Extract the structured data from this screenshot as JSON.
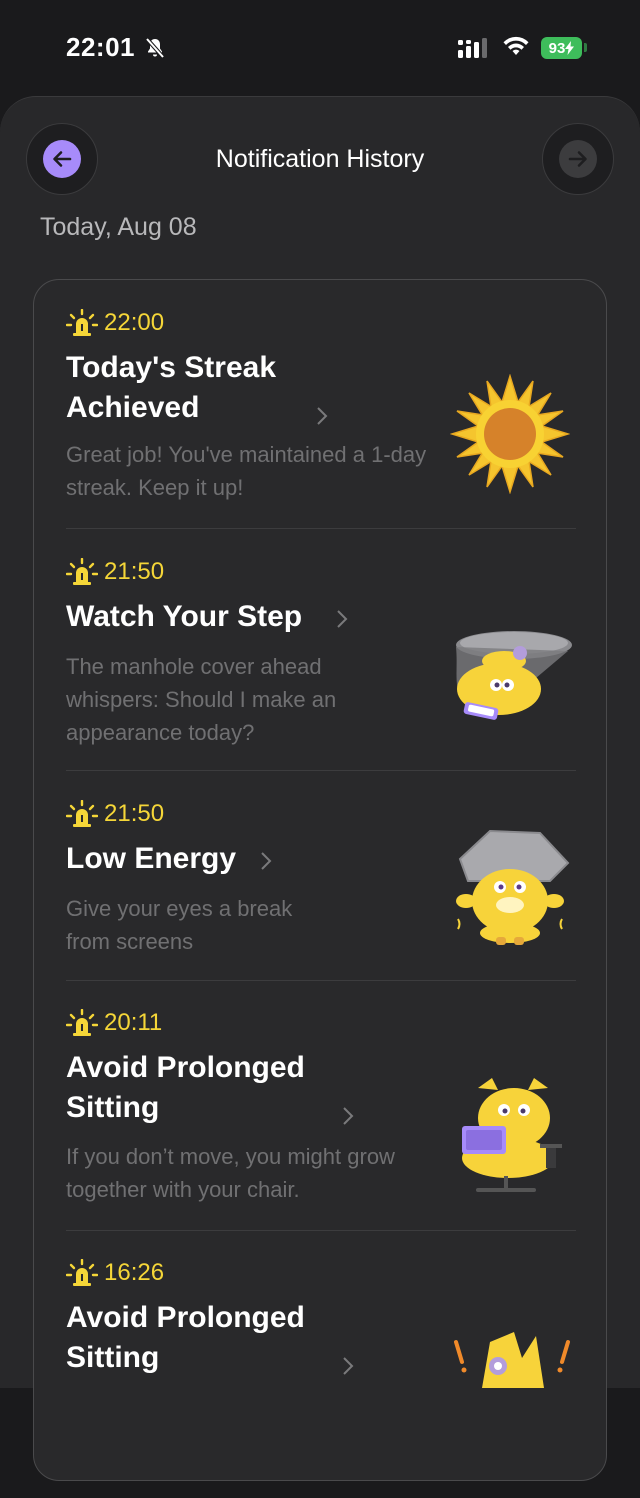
{
  "status_bar": {
    "time": "22:01",
    "battery": "93"
  },
  "header": {
    "title": "Notification History"
  },
  "date_label": "Today, Aug 08",
  "notifications": [
    {
      "time": "22:00",
      "title": "Today's Streak Achieved",
      "desc": "Great job! You've maintained a 1-day streak. Keep it up!",
      "icon": "sunflower-illustration"
    },
    {
      "time": "21:50",
      "title": "Watch Your Step",
      "desc": "The manhole cover ahead whispers: Should I make an appearance today?",
      "icon": "manhole-cat-illustration"
    },
    {
      "time": "21:50",
      "title": "Low Energy",
      "desc": "Give your eyes a break from screens",
      "icon": "tired-cat-illustration"
    },
    {
      "time": "20:11",
      "title": "Avoid Prolonged Sitting",
      "desc": "If you don’t move, you might grow together with your chair.",
      "icon": "laptop-cat-illustration"
    },
    {
      "time": "16:26",
      "title": "Avoid Prolonged Sitting",
      "desc": "",
      "icon": "alert-cat-illustration"
    }
  ],
  "colors": {
    "accent_yellow": "#f5d638",
    "back_button": "#a78bfa",
    "battery_green": "#3ebd5b"
  }
}
